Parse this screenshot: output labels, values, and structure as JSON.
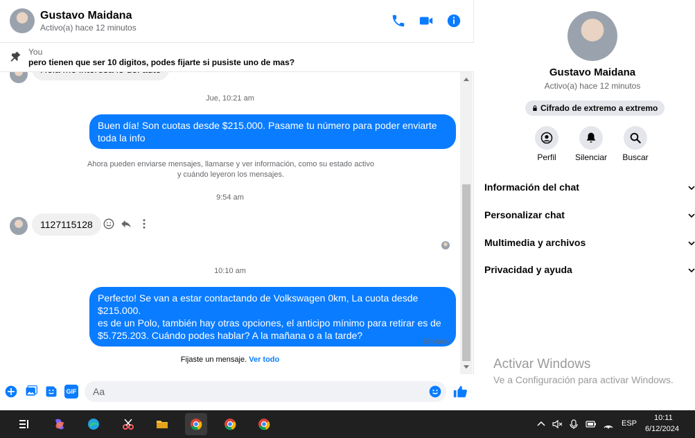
{
  "header": {
    "name": "Gustavo Maidana",
    "status": "Activo(a) hace 12 minutos"
  },
  "pinned": {
    "sender": "You",
    "text": "pero tienen que ser 10 digitos, podes fijarte si pusiste uno de mas?"
  },
  "messages": {
    "partial_top": "Hola me interesa lo del auto",
    "ts1": "Jue, 10:21 am",
    "out1": "Buen día! Son cuotas desde $215.000. Pasame tu número para poder enviarte toda la info",
    "sys_line1": "Ahora pueden enviarse mensajes, llamarse y ver información, como su estado activo",
    "sys_line2": "y cuándo leyeron los mensajes.",
    "ts2": "9:54 am",
    "in1": "1127115128",
    "ts3": "10:10 am",
    "out2_line1": "Perfecto!  Se van a estar contactando de Volkswagen 0km, La cuota desde $215.000.",
    "out2_line2": "es de un Polo, también hay otras opciones, el anticipo mínimo para retirar es de",
    "out2_line3": "$5.725.203. Cuándo podes hablar? A la mañana o a la tarde?",
    "sent_status": "Enviado",
    "pinned_note": "Fijaste un mensaje.",
    "pinned_link": "Ver todo"
  },
  "composer": {
    "placeholder": "Aa",
    "gif_label": "GIF"
  },
  "side": {
    "name": "Gustavo Maidana",
    "status": "Activo(a) hace 12 minutos",
    "e2e": "Cifrado de extremo a extremo",
    "buttons": [
      {
        "label": "Perfil",
        "icon": "profile-icon"
      },
      {
        "label": "Silenciar",
        "icon": "bell-icon"
      },
      {
        "label": "Buscar",
        "icon": "search-icon"
      }
    ],
    "sections": [
      "Información del chat",
      "Personalizar chat",
      "Multimedia y archivos",
      "Privacidad y ayuda"
    ],
    "watermark_title": "Activar Windows",
    "watermark_sub": "Ve a Configuración para activar Windows."
  },
  "taskbar": {
    "lang": "ESP",
    "time": "10:11",
    "date": "6/12/2024"
  },
  "colors": {
    "accent": "#0a7cff",
    "bubble_in": "#f0f0f0",
    "taskbar": "#202020"
  }
}
